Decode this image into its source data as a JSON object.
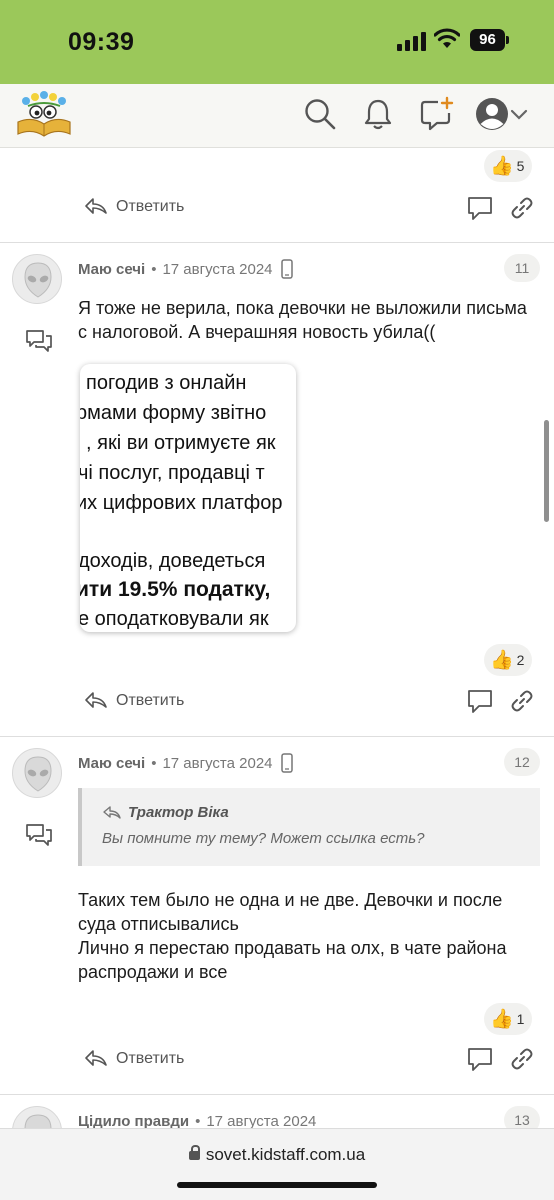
{
  "status_bar": {
    "time": "09:39",
    "battery": "96"
  },
  "header": {
    "logo_icon": "forum-logo-icon",
    "icons": [
      "search-icon",
      "bell-icon",
      "new-message-icon",
      "account-icon",
      "chevron-down-icon"
    ]
  },
  "posts": [
    {
      "reactions": {
        "icon": "thumbs-up",
        "count": "5"
      },
      "reply_label": "Ответить"
    },
    {
      "author": "Маю сечі",
      "dot": "•",
      "date": "17 августа 2024",
      "number": "11",
      "text": "Я тоже не верила, пока девочки не выложили письма с налоговой. А вчерашняя новость убила((",
      "image_lines": [
        "погодив з онлайн",
        "рмами форму звітно",
        ", які ви отримуєте як",
        "чі послуг, продавці т",
        "их цифрових платфор",
        "доходів, доведеться",
        "ити 19.5% податку,",
        "е оподатковували як"
      ],
      "reactions": {
        "icon": "thumbs-up",
        "count": "2"
      },
      "reply_label": "Ответить"
    },
    {
      "author": "Маю сечі",
      "dot": "•",
      "date": "17 августа 2024",
      "number": "12",
      "quote": {
        "author": "Трактор Віка",
        "text": "Вы помните ту тему? Может ссылка есть?"
      },
      "text_lines": [
        "Таких тем было не одна и не две. Девочки и после",
        "суда отписывались",
        "Лично я перестаю продавать на олх, в чате района",
        "распродажи и все"
      ],
      "reactions": {
        "icon": "thumbs-up",
        "count": "1"
      },
      "reply_label": "Ответить"
    },
    {
      "author": "Цідило правди",
      "dot": "•",
      "date": "17 августа 2024",
      "number": "13"
    }
  ],
  "browser": {
    "url": "sovet.kidstaff.com.ua"
  }
}
